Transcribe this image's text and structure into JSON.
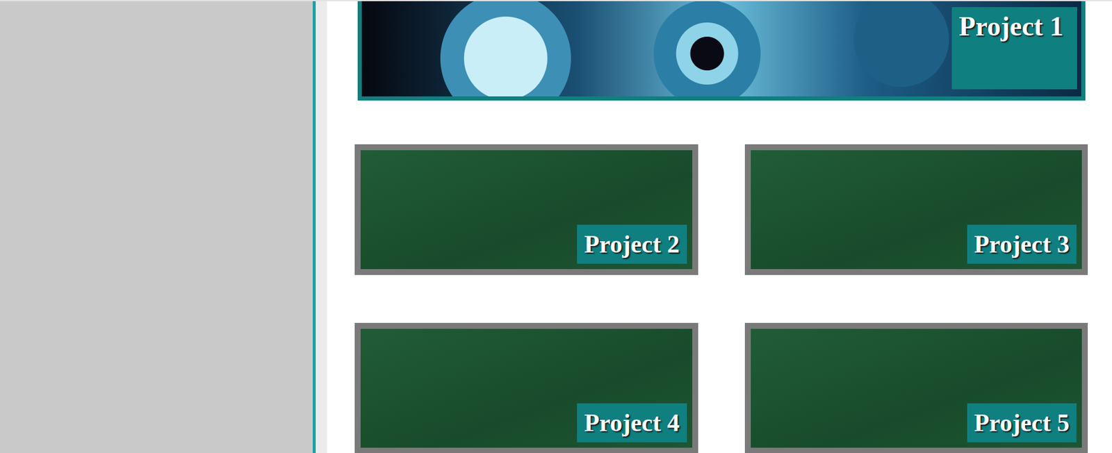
{
  "projects": [
    {
      "label": "Project 1",
      "kind": "featured"
    },
    {
      "label": "Project 2",
      "kind": "tile"
    },
    {
      "label": "Project 3",
      "kind": "tile"
    },
    {
      "label": "Project 4",
      "kind": "tile"
    },
    {
      "label": "Project 5",
      "kind": "tile"
    }
  ]
}
